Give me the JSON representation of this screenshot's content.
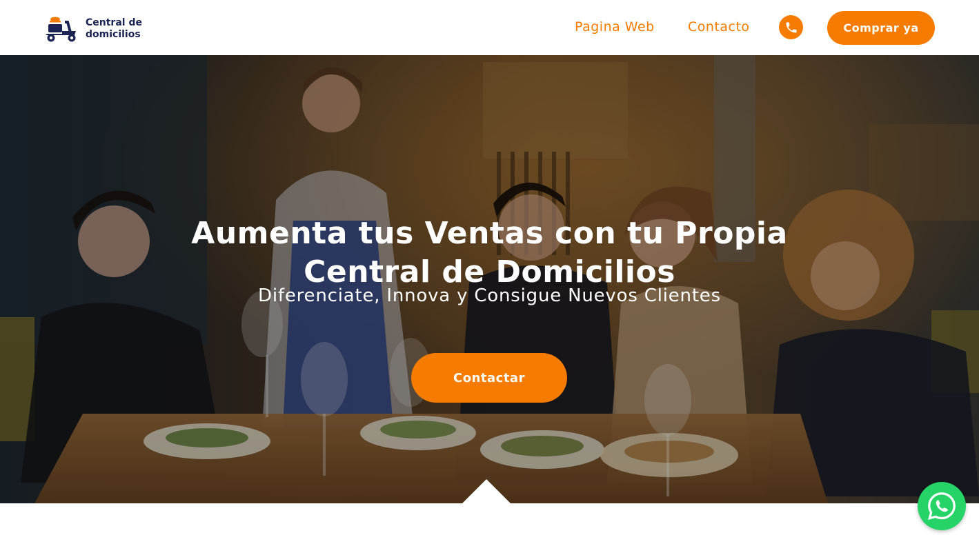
{
  "colors": {
    "accent": "#f57c00",
    "brand_dark": "#1b2452",
    "whatsapp": "#25d366",
    "text_light": "#ffffff"
  },
  "header": {
    "logo_line1": "Central de",
    "logo_line2": "domicilios",
    "nav": {
      "web": "Pagina Web",
      "contact": "Contacto"
    },
    "phone_icon": "phone-icon",
    "buy_label": "Comprar ya"
  },
  "hero": {
    "background": "restaurant-photo",
    "title": "Aumenta tus Ventas con tu Propia\nCentral de Domicilios",
    "subtitle": "Diferenciate, Innova y Consigue Nuevos Clientes",
    "cta_label": "Contactar"
  },
  "floating": {
    "whatsapp_icon": "whatsapp-icon"
  }
}
